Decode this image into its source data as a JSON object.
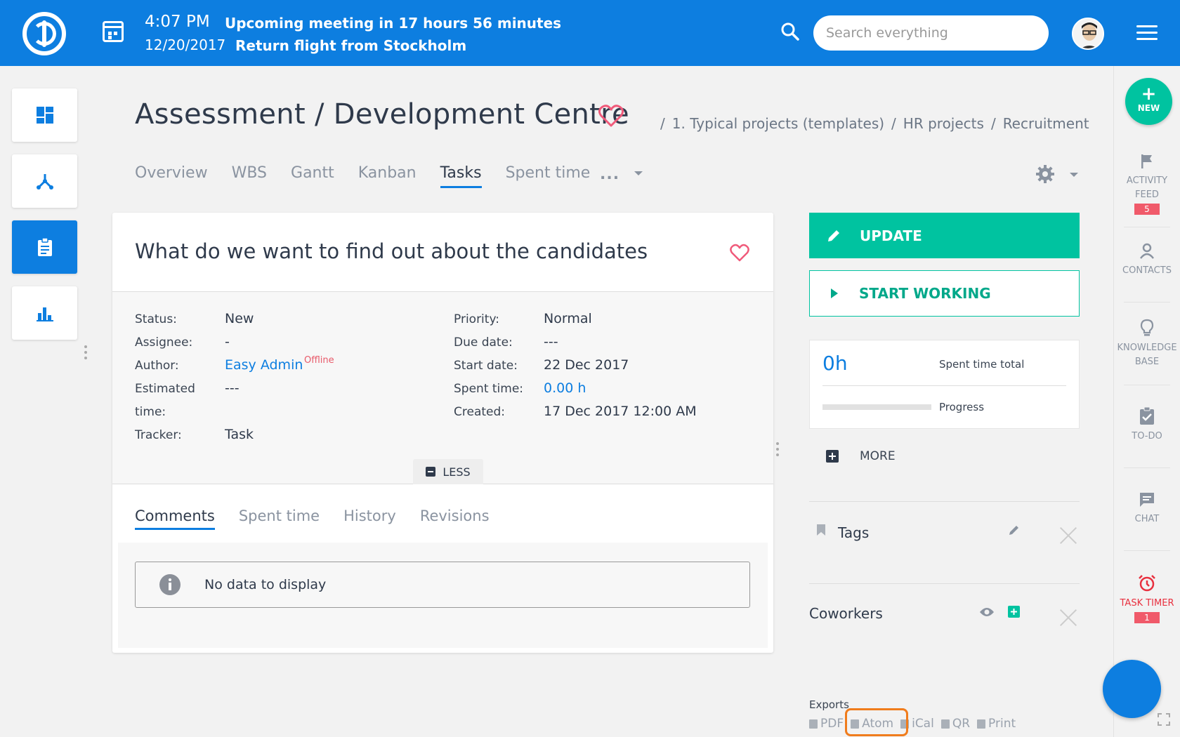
{
  "header": {
    "time": "4:07 PM",
    "date": "12/20/2017",
    "event1": "Upcoming meeting in 17 hours 56 minutes",
    "event2": "Return flight from Stockholm",
    "search_placeholder": "Search everything"
  },
  "page": {
    "title": "Assessment / Development Centre",
    "breadcrumb": [
      "/",
      "1. Typical projects (templates)",
      "/",
      "HR projects",
      "/",
      "Recruitment"
    ]
  },
  "tabs": [
    {
      "label": "Overview"
    },
    {
      "label": "WBS"
    },
    {
      "label": "Gantt"
    },
    {
      "label": "Kanban"
    },
    {
      "label": "Tasks",
      "active": true
    },
    {
      "label": "Spent time"
    }
  ],
  "tabs_more": "...",
  "task": {
    "title": "What do we want to find out about the candidates",
    "status_label": "Status:",
    "status": "New",
    "assignee_label": "Assignee:",
    "assignee": "-",
    "author_label": "Author:",
    "author": "Easy Admin",
    "author_status": "Offline",
    "estimated_label_1": "Estimated",
    "estimated_label_2": "time:",
    "estimated": "---",
    "tracker_label": "Tracker:",
    "tracker": "Task",
    "priority_label": "Priority:",
    "priority": "Normal",
    "due_label": "Due date:",
    "due": "---",
    "start_label": "Start date:",
    "start": "22 Dec 2017",
    "spent_label": "Spent time:",
    "spent": "0.00 h",
    "created_label": "Created:",
    "created": "17 Dec 2017 12:00 AM",
    "less_label": "LESS"
  },
  "comment_tabs": [
    "Comments",
    "Spent time",
    "History",
    "Revisions"
  ],
  "no_data": "No data to display",
  "actions": {
    "update": "UPDATE",
    "start_working": "START WORKING"
  },
  "spent_box": {
    "hours": "0h",
    "spent_label": "Spent time total",
    "progress_label": "Progress",
    "progress_percent": 0
  },
  "more_label": "MORE",
  "tags_label": "Tags",
  "coworkers_label": "Coworkers",
  "exports": {
    "label": "Exports",
    "items": [
      "PDF",
      "Atom",
      "iCal",
      "QR",
      "Print"
    ]
  },
  "right_sidebar": {
    "new": "NEW",
    "activity_1": "ACTIVITY",
    "activity_2": "FEED",
    "activity_badge": "5",
    "contacts": "CONTACTS",
    "kb_1": "KNOWLEDGE",
    "kb_2": "BASE",
    "todo": "TO-DO",
    "chat": "CHAT",
    "timer": "TASK TIMER",
    "timer_badge": "1"
  },
  "colors": {
    "brand_blue": "#0d7ee0",
    "accent_green": "#00c3a0",
    "heart_pink": "#f05a7a",
    "highlight_orange": "#f07c1c"
  }
}
